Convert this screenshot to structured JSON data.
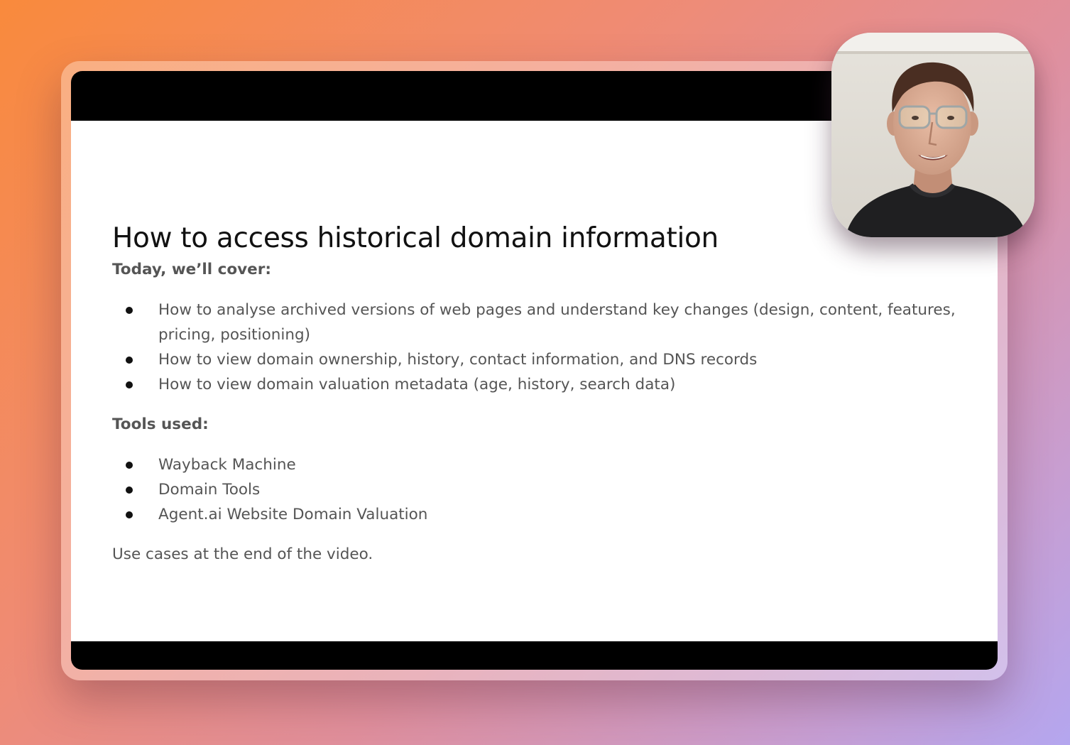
{
  "slide": {
    "title": "How to access historical domain information",
    "section1": {
      "heading": "Today, we’ll cover:",
      "items": [
        "How to analyse archived versions of web pages and understand key changes (design, content, features, pricing, positioning)",
        "How to view domain ownership, history, contact information, and DNS records",
        "How to view domain valuation metadata (age, history, search data)"
      ]
    },
    "section2": {
      "heading": "Tools used:",
      "items": [
        "Wayback Machine",
        "Domain Tools",
        "Agent.ai Website Domain Valuation"
      ]
    },
    "footer_note": "Use cases at the end of the video."
  },
  "colors": {
    "background_start": "#f98a3c",
    "background_end": "#b4a6ef",
    "letterbox": "#000000",
    "slide_bg": "#ffffff",
    "title_text": "#111111",
    "body_text": "#555555"
  },
  "webcam": {
    "icon": "presenter-video"
  }
}
